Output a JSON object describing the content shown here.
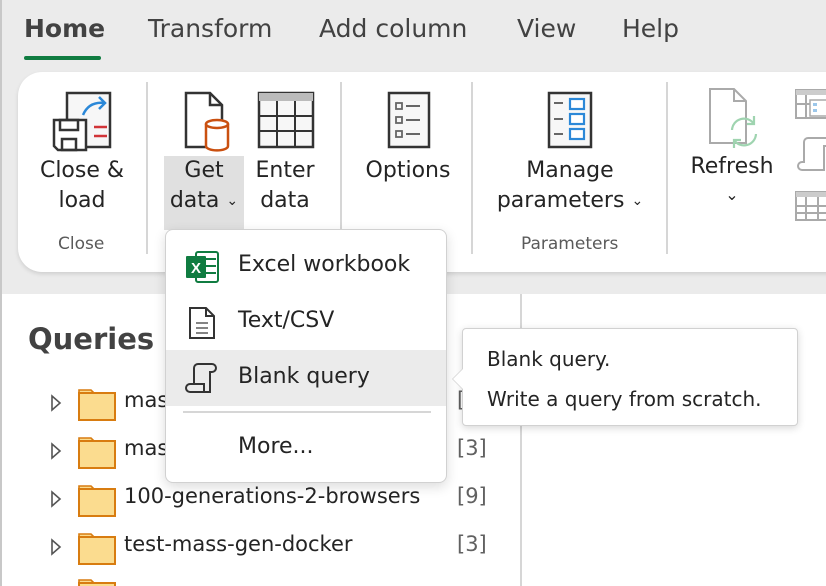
{
  "tabs": [
    {
      "label": "Home",
      "active": true
    },
    {
      "label": "Transform",
      "active": false
    },
    {
      "label": "Add column",
      "active": false
    },
    {
      "label": "View",
      "active": false
    },
    {
      "label": "Help",
      "active": false
    }
  ],
  "accent_color": "#107c41",
  "ribbon": {
    "close_load": {
      "line1": "Close &",
      "line2": "load",
      "icon": "close-load-icon"
    },
    "close_group_label": "Close",
    "get_data": {
      "line1": "Get",
      "line2": "data",
      "chevron": "⌄",
      "icon": "get-data-icon"
    },
    "enter_data": {
      "line1": "Enter",
      "line2": "data",
      "icon": "table-icon"
    },
    "options": {
      "label": "Options",
      "icon": "options-icon"
    },
    "manage_parameters": {
      "line1": "Manage",
      "line2": "parameters",
      "chevron": "⌄",
      "icon": "manage-parameters-icon"
    },
    "parameters_group_label": "Parameters",
    "refresh": {
      "label": "Refresh",
      "chevron": "⌄",
      "icon": "refresh-icon"
    }
  },
  "get_data_menu": {
    "items": [
      {
        "label": "Excel workbook",
        "icon": "excel-icon"
      },
      {
        "label": "Text/CSV",
        "icon": "text-file-icon"
      },
      {
        "label": "Blank query",
        "icon": "blank-query-icon",
        "highlighted": true
      }
    ],
    "more_label": "More..."
  },
  "tooltip": {
    "line1": "Blank query.",
    "line2": "Write a query from scratch."
  },
  "queries_pane": {
    "title": "Queries [",
    "items": [
      {
        "name": "mas",
        "count": "["
      },
      {
        "name": "mas",
        "count": "[3]"
      },
      {
        "name": "100-generations-2-browsers",
        "count": "[9]"
      },
      {
        "name": "test-mass-gen-docker",
        "count": "[3]"
      }
    ]
  }
}
